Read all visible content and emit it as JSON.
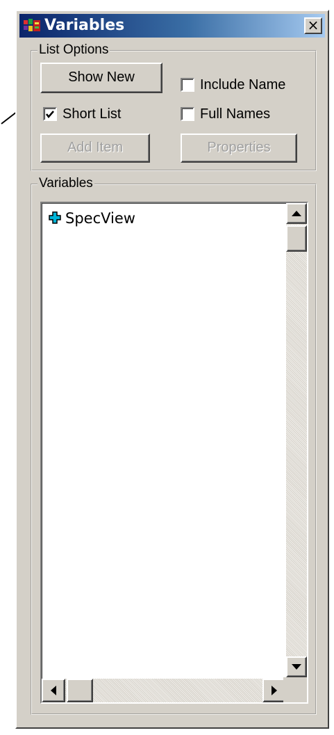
{
  "window": {
    "title": "Variables",
    "close_glyph": "×",
    "icon": "variables-app-icon"
  },
  "list_options": {
    "legend": "List Options",
    "show_new_label": "Show New",
    "include_name_label": "Include Name",
    "include_name_checked": false,
    "short_list_label": "Short List",
    "short_list_checked": true,
    "full_names_label": "Full Names",
    "full_names_checked": false,
    "add_item_label": "Add Item",
    "add_item_enabled": false,
    "properties_label": "Properties",
    "properties_enabled": false
  },
  "variables": {
    "legend": "Variables",
    "items": [
      {
        "label": "SpecView",
        "icon": "expand-plus-icon"
      }
    ]
  },
  "colors": {
    "title_gradient_start": "#0a246a",
    "title_gradient_end": "#a6caf0",
    "face": "#d4d0c8",
    "tree_icon": "#00b4d8"
  }
}
